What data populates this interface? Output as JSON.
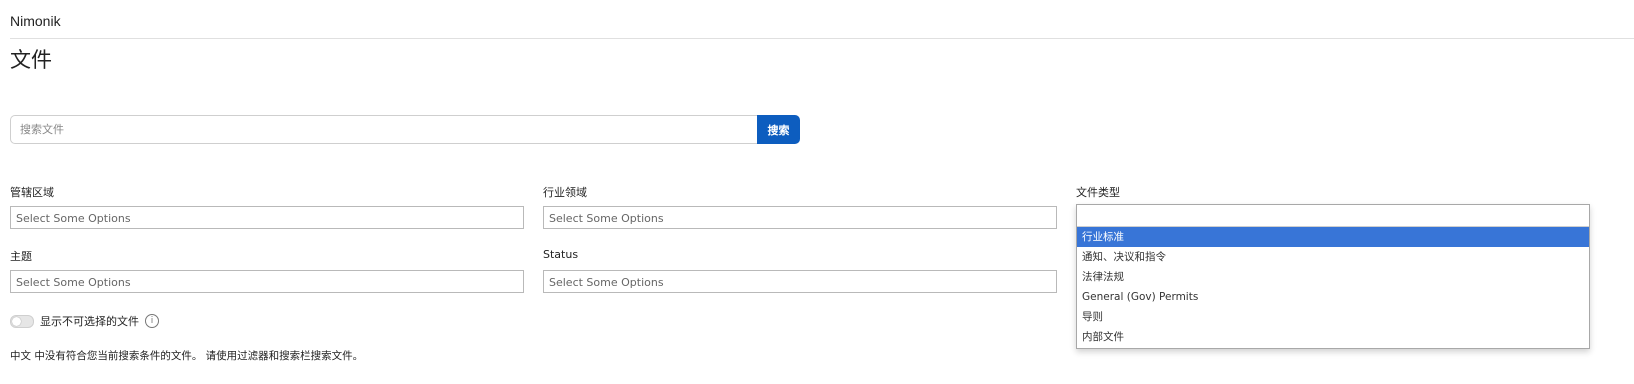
{
  "header": {
    "brand": "Nimonik"
  },
  "page": {
    "title": "文件"
  },
  "search": {
    "placeholder": "搜索文件",
    "button_label": "搜索"
  },
  "filters": {
    "jurisdiction": {
      "label": "管辖区域",
      "placeholder": "Select Some Options"
    },
    "industry": {
      "label": "行业领域",
      "placeholder": "Select Some Options"
    },
    "doc_type": {
      "label": "文件类型"
    },
    "topic": {
      "label": "主题",
      "placeholder": "Select Some Options"
    },
    "status": {
      "label": "Status",
      "placeholder": "Select Some Options"
    }
  },
  "doc_type_dropdown": {
    "options": [
      "行业标准",
      "通知、决议和指令",
      "法律法规",
      "General (Gov) Permits",
      "导则",
      "内部文件"
    ],
    "highlighted_index": 0
  },
  "toggle": {
    "label": "显示不可选择的文件",
    "on": false
  },
  "info_icon": "info-icon",
  "empty_message": "中文 中没有符合您当前搜索条件的文件。 请使用过滤器和搜索栏搜索文件。",
  "colors": {
    "accent": "#0d5dbf",
    "highlight": "#3875d7"
  }
}
